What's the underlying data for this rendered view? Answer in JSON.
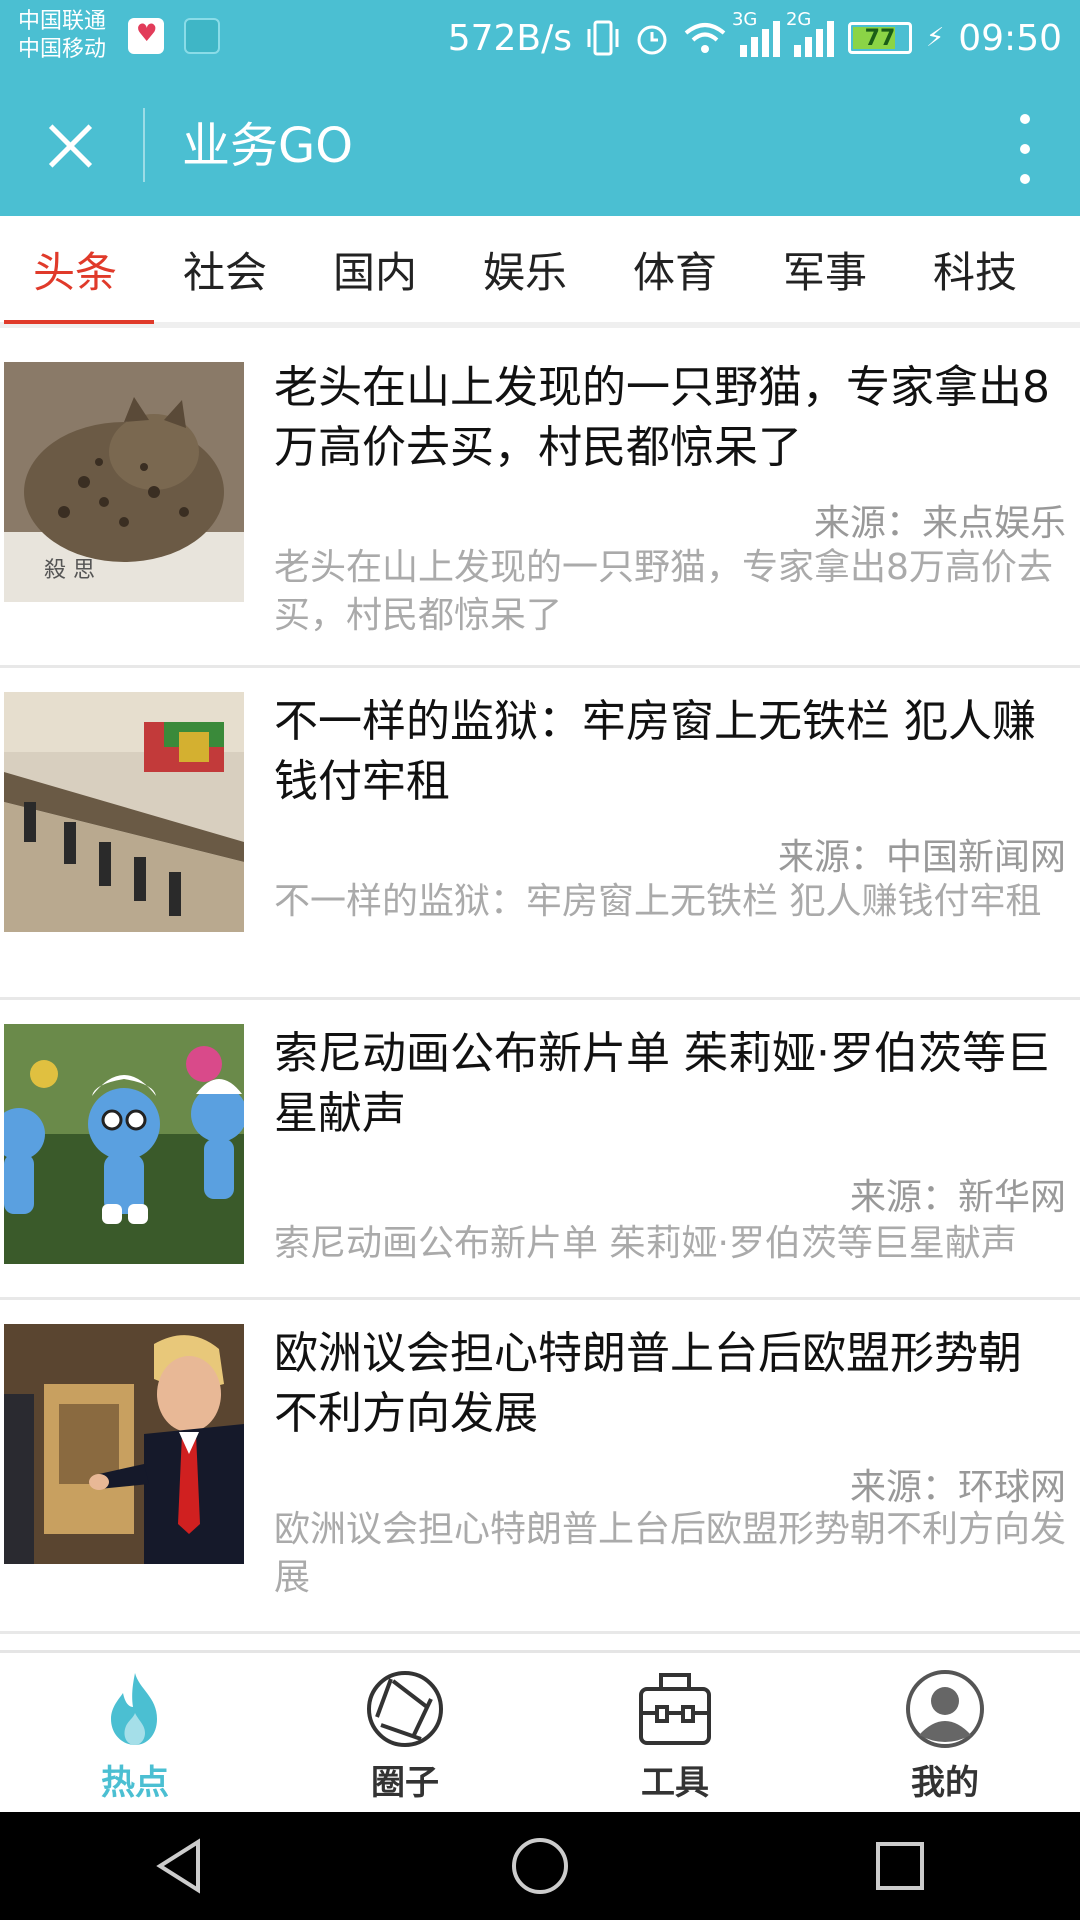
{
  "status_bar": {
    "carrier1": "中国联通",
    "carrier2": "中国移动",
    "speed": "572B/s",
    "net1": "3G",
    "net2": "2G",
    "battery": "77",
    "time": "09:50"
  },
  "header": {
    "title": "业务GO"
  },
  "tabs": [
    {
      "label": "头条",
      "active": true
    },
    {
      "label": "社会"
    },
    {
      "label": "国内"
    },
    {
      "label": "娱乐"
    },
    {
      "label": "体育"
    },
    {
      "label": "军事"
    },
    {
      "label": "科技"
    }
  ],
  "articles": [
    {
      "title": "老头在山上发现的一只野猫，专家拿出8万高价去买，村民都惊呆了",
      "source": "来源：来点娱乐",
      "summary": "老头在山上发现的一只野猫，专家拿出8万高价去买，村民都惊呆了"
    },
    {
      "title": "不一样的监狱：牢房窗上无铁栏 犯人赚钱付牢租",
      "source": "来源：中国新闻网",
      "summary": "不一样的监狱：牢房窗上无铁栏 犯人赚钱付牢租"
    },
    {
      "title": "索尼动画公布新片单 茱莉娅·罗伯茨等巨星献声",
      "source": "来源：新华网",
      "summary": "索尼动画公布新片单 茱莉娅·罗伯茨等巨星献声"
    },
    {
      "title": "欧洲议会担心特朗普上台后欧盟形势朝不利方向发展",
      "source": "来源：环球网",
      "summary": "欧洲议会担心特朗普上台后欧盟形势朝不利方向发展"
    }
  ],
  "bottom_nav": [
    {
      "label": "热点",
      "icon": "flame-icon",
      "active": true
    },
    {
      "label": "圈子",
      "icon": "aperture-icon"
    },
    {
      "label": "工具",
      "icon": "toolbox-icon"
    },
    {
      "label": "我的",
      "icon": "user-icon"
    }
  ],
  "colors": {
    "brand": "#4bbfd2",
    "tab_active": "#e03a2a"
  }
}
